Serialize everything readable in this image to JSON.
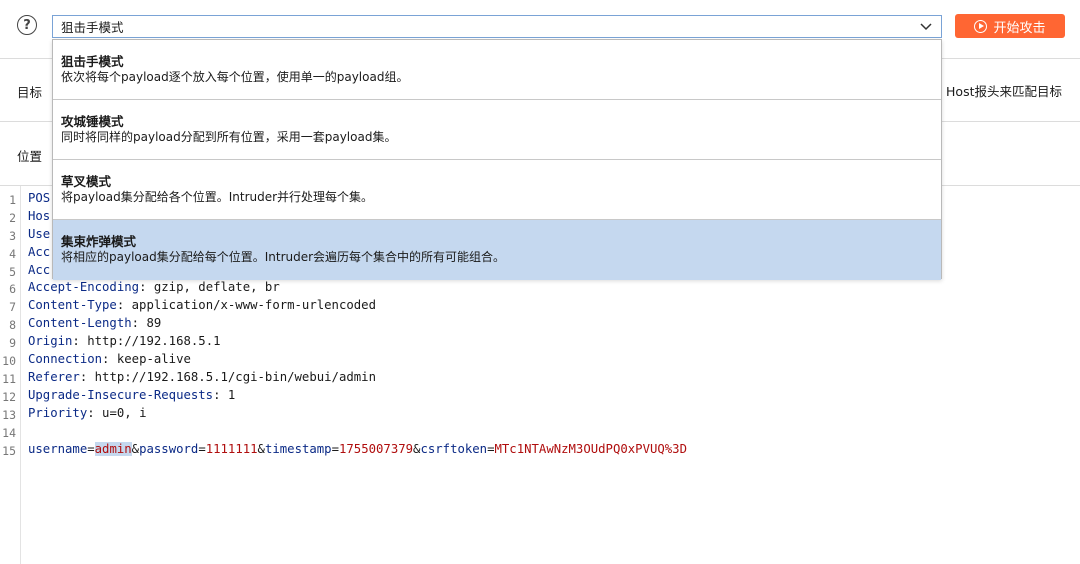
{
  "toolbar": {
    "help_icon": "?",
    "mode_selected": "狙击手模式",
    "start_label": "开始攻击",
    "accent_color": "#ff6633"
  },
  "sections": {
    "target_label": "目标",
    "host_hint": "Host报头来匹配目标",
    "positions_label": "位置"
  },
  "dropdown": {
    "options": [
      {
        "title": "狙击手模式",
        "desc": "依次将每个payload逐个放入每个位置，使用单一的payload组。"
      },
      {
        "title": "攻城锤模式",
        "desc": "同时将同样的payload分配到所有位置，采用一套payload集。"
      },
      {
        "title": "草叉模式",
        "desc": "将payload集分配给各个位置。Intruder并行处理每个集。"
      },
      {
        "title": "集束炸弹模式",
        "desc": "将相应的payload集分配给每个位置。Intruder会遍历每个集合中的所有可能组合。"
      }
    ],
    "selected_index": 3
  },
  "request": {
    "line_numbers": [
      "1",
      "2",
      "3",
      "4",
      "5",
      "6",
      "7",
      "8",
      "9",
      "10",
      "11",
      "12",
      "13",
      "14",
      "15"
    ],
    "hidden_prefixes": [
      "POS",
      "Hos",
      "Use",
      "Acc",
      "Acc"
    ],
    "headers": [
      {
        "key": "Accept-Encoding",
        "sep": ": ",
        "value": "gzip, deflate, br"
      },
      {
        "key": "Content-Type",
        "sep": ": ",
        "value": "application/x-www-form-urlencoded"
      },
      {
        "key": "Content-Length",
        "sep": ": ",
        "value": "89"
      },
      {
        "key": "Origin",
        "sep": ": ",
        "value": "http://192.168.5.1"
      },
      {
        "key": "Connection",
        "sep": ": ",
        "value": "keep-alive"
      },
      {
        "key": "Referer",
        "sep": ": ",
        "value": "http://192.168.5.1/cgi-bin/webui/admin"
      },
      {
        "key": "Upgrade-Insecure-Requests",
        "sep": ": ",
        "value": "1"
      },
      {
        "key": "Priority",
        "sep": ": ",
        "value": "u=0, i"
      }
    ],
    "body": {
      "k1": "username",
      "eq": "=",
      "v1": "admin",
      "amp1": "&",
      "k2": "password",
      "v2": "1111111",
      "amp2": "&",
      "k3": "timestamp",
      "v3": "1755007379",
      "amp3": "&",
      "k4": "csrftoken",
      "v4": "MTc1NTAwNzM3OUdPQ0xPVUQ%3D"
    }
  }
}
